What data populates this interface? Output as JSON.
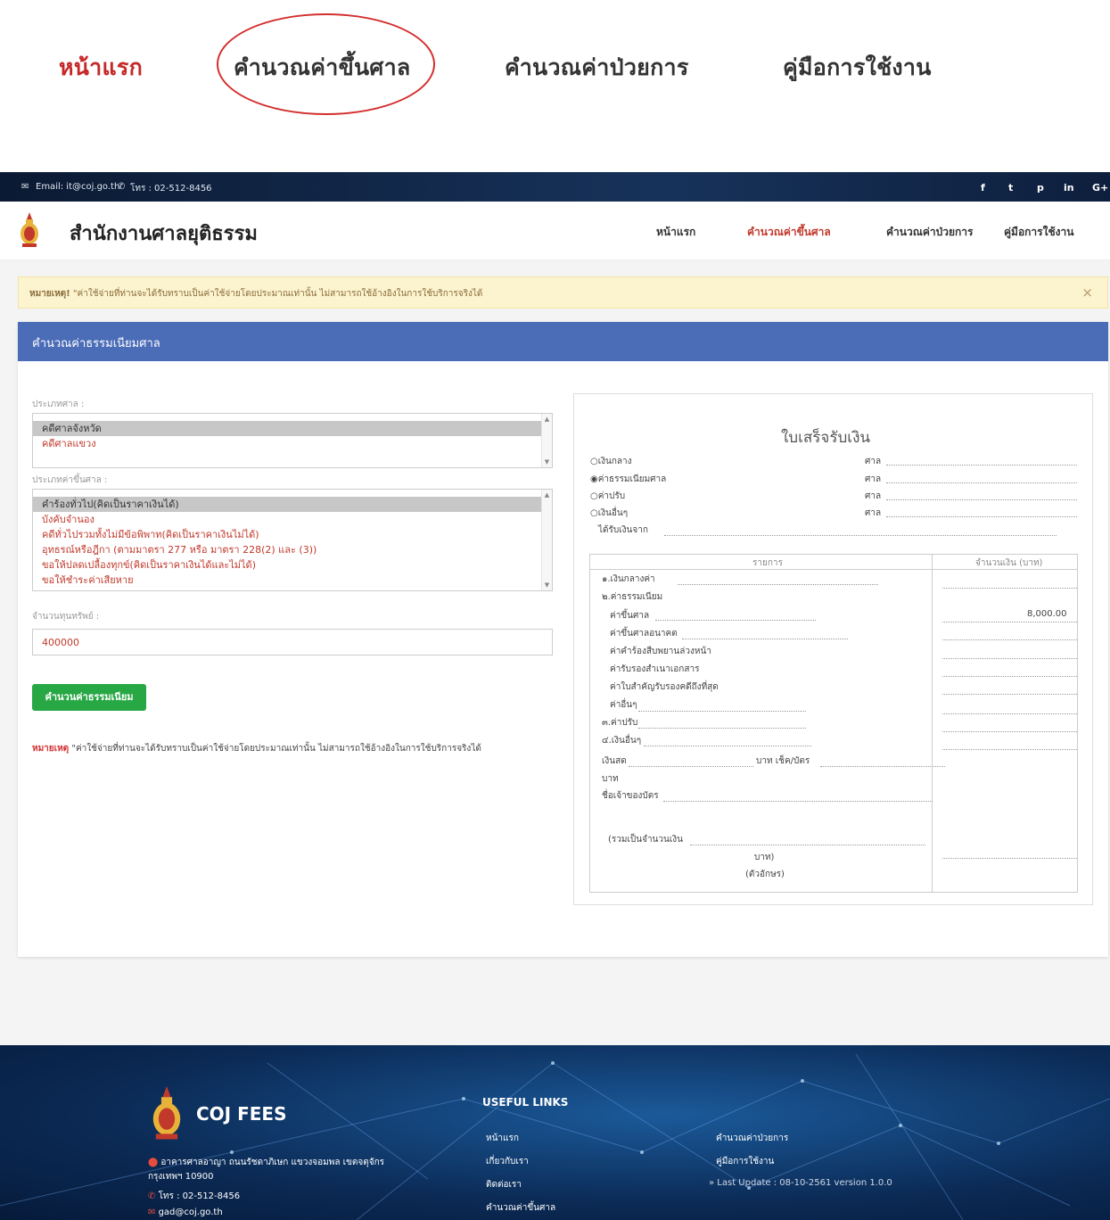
{
  "callout": {
    "nav": [
      "หน้าแรก",
      "คำนวณค่าขึ้นศาล",
      "คำนวณค่าป่วยการ",
      "คู่มือการใช้งาน"
    ]
  },
  "topbar": {
    "email": "Email: it@coj.go.th",
    "phone": "โทร : 02-512-8456",
    "social": [
      "f",
      "t",
      "p",
      "in",
      "G+"
    ]
  },
  "header": {
    "title": "สำนักงานศาลยุติธรรม",
    "nav": [
      "หน้าแรก",
      "คำนวณค่าขึ้นศาล",
      "คำนวณค่าป่วยการ",
      "คู่มือการใช้งาน"
    ],
    "active_color": "#c0392b"
  },
  "alert": {
    "label": "หมายเหตุ!",
    "text": " \"ค่าใช้จ่ายที่ท่านจะได้รับทราบเป็นค่าใช้จ่ายโดยประมาณเท่านั้น ไม่สามารถใช้อ้างอิงในการใช้บริการจริงได้",
    "close": "×"
  },
  "panel": {
    "title": "คำนวณค่าธรรมเนียมศาล",
    "court_type_label": "ประเภทศาล :",
    "court_types": [
      "คดีศาลจังหวัด",
      "คดีศาลแขวง"
    ],
    "fee_type_label": "ประเภทค่าขึ้นศาล :",
    "fee_types": [
      "คำร้องทั่วไป(คิดเป็นราคาเงินได้)",
      "บังคับจำนอง",
      "คดีทั่วไปรวมทั้งไม่มีข้อพิพาท(คิดเป็นราคาเงินไม่ได้)",
      "อุทธรณ์หรือฎีกา (ตามมาตรา 277 หรือ มาตรา 228(2) และ (3))",
      "ขอให้ปลดเปลื้องทุกข์(คิดเป็นราคาเงินได้และไม่ได้)",
      "ขอให้ชำระค่าเสียหาย"
    ],
    "capital_label": "จำนวนทุนทรัพย์ :",
    "capital_value": "400000",
    "calc_button": "คำนวนค่าธรรมเนียม",
    "note_label": "หมายเหตุ",
    "note_text": " \"ค่าใช้จ่ายที่ท่านจะได้รับทราบเป็นค่าใช้จ่ายโดยประมาณเท่านั้น ไม่สามารถใช้อ้างอิงในการใช้บริการจริงได้"
  },
  "receipt": {
    "title": "ใบเสร็จรับเงิน",
    "options": [
      "เงินกลาง",
      "ค่าธรรมเนียมศาล",
      "ค่าปรับ",
      "เงินอื่นๆ"
    ],
    "court_word": "ศาล",
    "received_from": "ได้รับเงินจาก",
    "col_item": "รายการ",
    "col_amount": "จำนวนเงิน (บาท)",
    "rows": [
      "๑.เงินกลางค่า",
      "๒.ค่าธรรมเนียม",
      "ค่าขึ้นศาล",
      "ค่าขึ้นศาลอนาคต",
      "ค่าคำร้องสืบพยานล่วงหน้า",
      "ค่ารับรองสำเนาเอกสาร",
      "ค่าใบสำคัญรับรองคดีถึงที่สุด",
      "ค่าอื่นๆ",
      "๓.ค่าปรับ",
      "๔.เงินอื่นๆ"
    ],
    "court_fee_amount": "8,000.00",
    "cash": "เงินสด",
    "baht_cheque": "บาท เช็ค/บัตร",
    "baht": "บาท",
    "card_owner": "ชื่อเจ้าของบัตร",
    "total_open": "(รวมเป็นจำนวนเงิน",
    "total_baht": "บาท)",
    "in_words": "(ตัวอักษร)"
  },
  "footer": {
    "title": "COJ FEES",
    "address": "อาคารศาลอาญา ถนนรัชดาภิเษก แขวงจอมพล เขตจตุจักร",
    "address2": "กรุงเทพฯ 10900",
    "phone": "โทร : 02-512-8456",
    "email": "gad@coj.go.th",
    "links_heading": "USEFUL LINKS",
    "links_left": [
      "หน้าแรก",
      "เกี่ยวกับเรา",
      "ติดต่อเรา",
      "คำนวณค่าขึ้นศาล"
    ],
    "links_right": [
      "คำนวณค่าป่วยการ",
      "คู่มือการใช้งาน"
    ],
    "last_update": "» Last Update : 08-10-2561 version 1.0.0"
  }
}
